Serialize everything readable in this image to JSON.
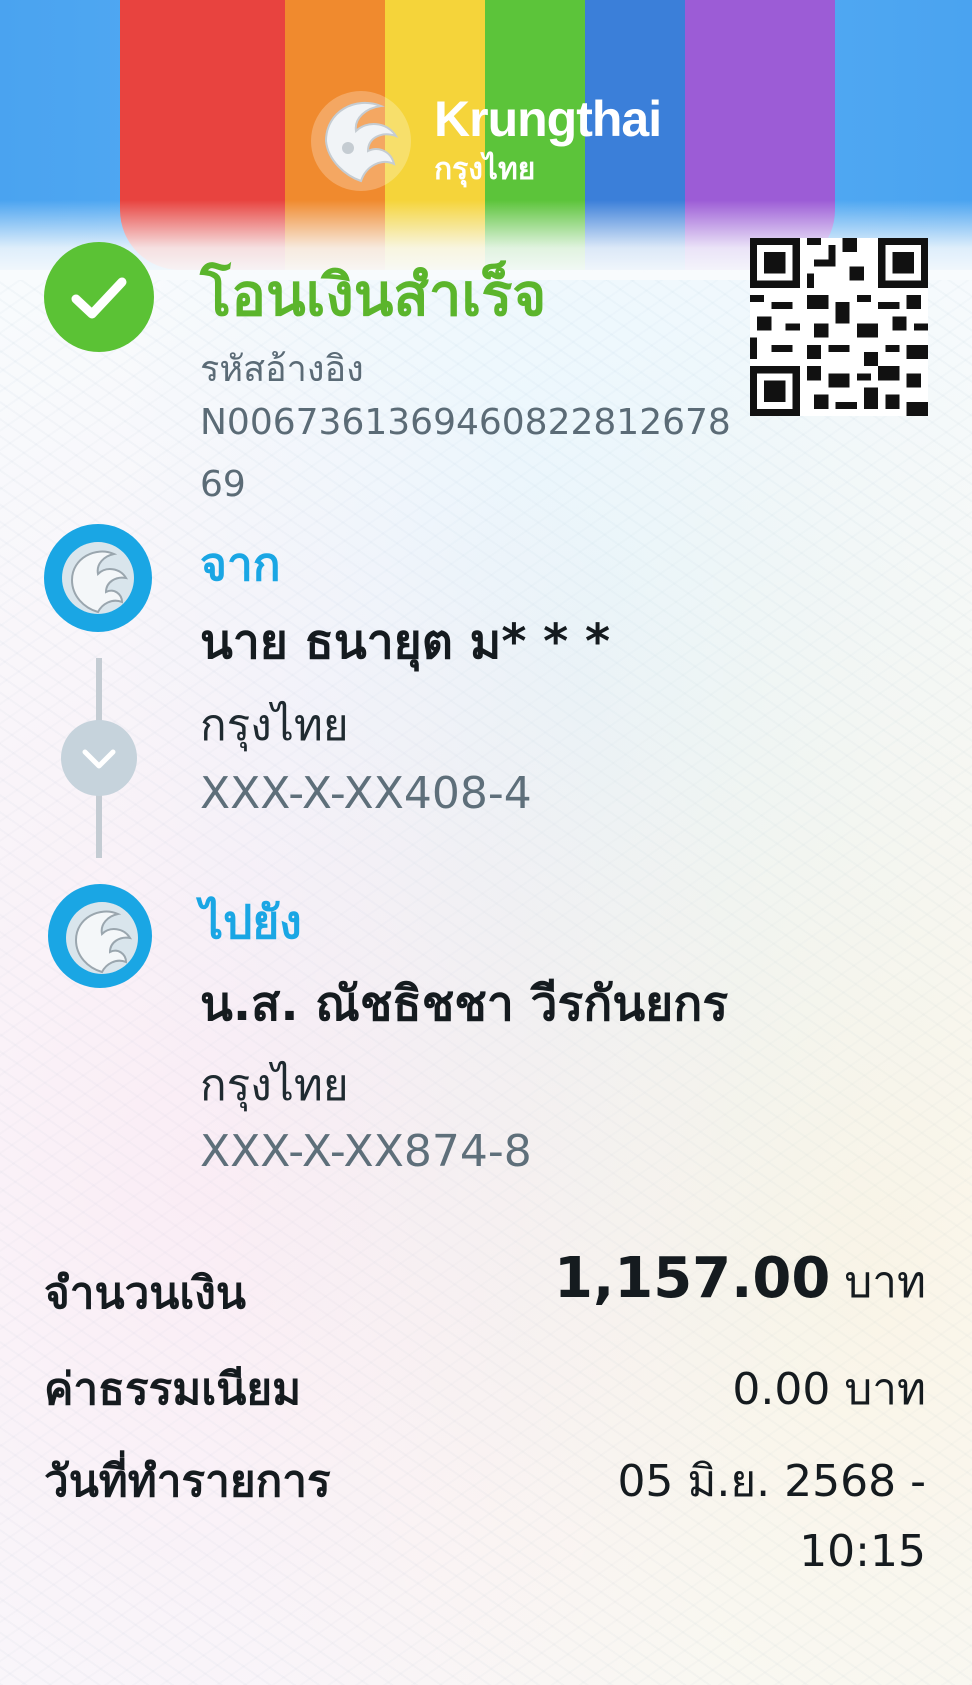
{
  "brand": {
    "name_en": "Krungthai",
    "name_th": "กรุงไทย",
    "stripe_colors": [
      "#e8433f",
      "#f08a2e",
      "#f5d43a",
      "#5cc43a",
      "#3b7fd9",
      "#9c5cd6"
    ]
  },
  "status": {
    "title": "โอนเงินสำเร็จ",
    "icon": "check-circle-icon",
    "color": "#5bc235"
  },
  "reference": {
    "label": "รหัสอ้างอิง",
    "line1": "N0067361369460822812678",
    "line2": "69"
  },
  "from": {
    "label": "จาก",
    "name": "นาย ธนายุต ม* * *",
    "bank": "กรุงไทย",
    "account": "XXX-X-XX408-4"
  },
  "to": {
    "label": "ไปยัง",
    "name": "น.ส. ณัชธิชชา วีรกันยกร",
    "bank": "กรุงไทย",
    "account": "XXX-X-XX874-8"
  },
  "summary": {
    "amount_label": "จำนวนเงิน",
    "amount_value": "1,157.00",
    "amount_unit": "บาท",
    "fee_label": "ค่าธรรมเนียม",
    "fee_value": "0.00 บาท",
    "date_label": "วันที่ทำรายการ",
    "date_line1": "05 มิ.ย. 2568 -",
    "date_line2": "10:15"
  },
  "accent": "#1aa6e4"
}
